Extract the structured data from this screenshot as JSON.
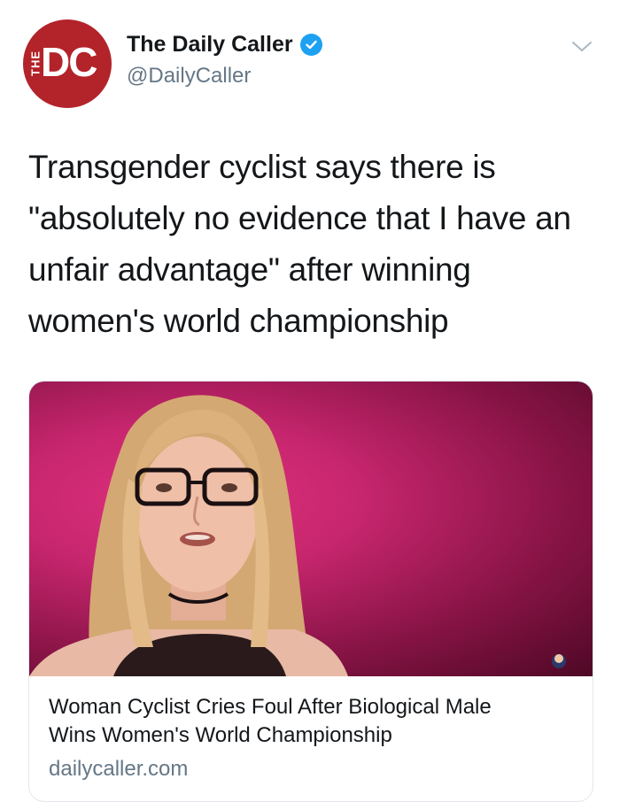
{
  "account": {
    "avatar_text": "DC",
    "avatar_side_text": "THE",
    "display_name": "The Daily Caller",
    "handle": "@DailyCaller",
    "verified_icon": "verified-badge-icon",
    "menu_icon": "chevron-down-icon"
  },
  "tweet": {
    "lines": [
      "Transgender cyclist says there is",
      "\"absolutely no evidence that I have an",
      "unfair advantage\" after winning",
      "women's world championship"
    ]
  },
  "card": {
    "image_icon": "person-photo",
    "title_lines": [
      "Woman Cyclist Cries Foul After Biological Male",
      "Wins Women's World Championship"
    ],
    "domain": "dailycaller.com"
  },
  "colors": {
    "brand_red": "#b3232a",
    "verified_blue": "#1da1f2",
    "secondary_text": "#657786",
    "card_border": "#e1e8ed"
  }
}
